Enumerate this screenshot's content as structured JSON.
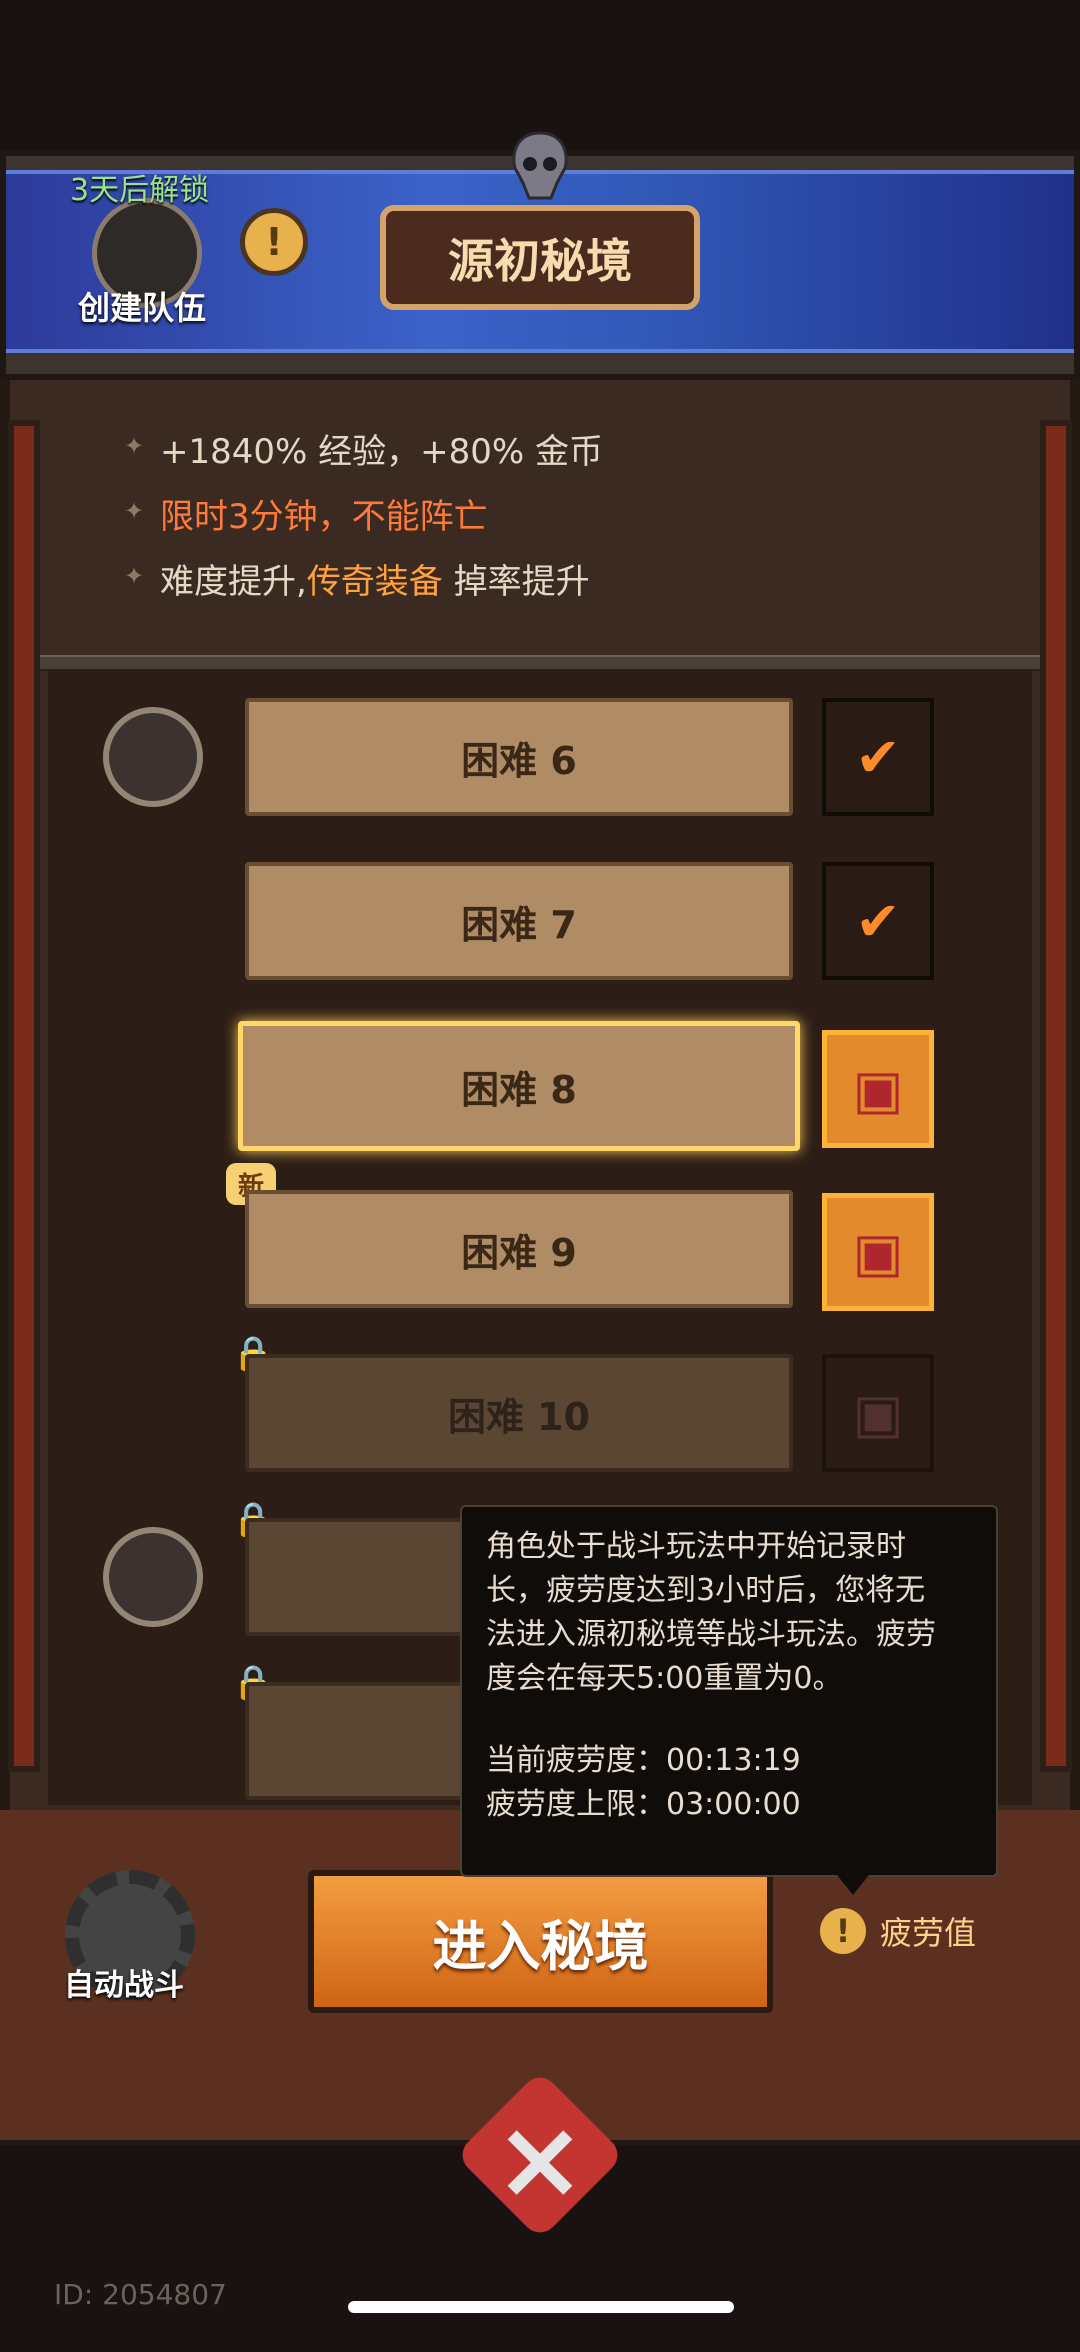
{
  "header": {
    "title": "源初秘境",
    "team": {
      "timer": "3天后解锁",
      "label": "创建队伍"
    },
    "info_icon": "exclamation-icon"
  },
  "description": {
    "line1": "+1840% 经验，+80% 金币",
    "line2": "限时3分钟，不能阵亡",
    "line3_prefix": "难度提升,",
    "line3_highlight": "传奇装备",
    "line3_suffix": " 掉率提升"
  },
  "levels": [
    {
      "label": "困难 6",
      "state": "cleared"
    },
    {
      "label": "困难 7",
      "state": "cleared"
    },
    {
      "label": "困难 8",
      "state": "selected"
    },
    {
      "label": "困难 9",
      "state": "new"
    },
    {
      "label": "困难 10",
      "state": "locked"
    }
  ],
  "new_badge": "新",
  "auto_battle": {
    "label": "自动战斗"
  },
  "enter_button": "进入秘境",
  "fatigue": {
    "label": "疲劳值"
  },
  "tooltip": {
    "line1": "角色处于战斗玩法中开始记录时",
    "line2": "长，疲劳度达到3小时后，您将无",
    "line3": "法进入源初秘境等战斗玩法。疲劳",
    "line4": "度会在每天5:00重置为0。",
    "current": "当前疲劳度：00:13:19",
    "limit": "疲劳度上限：03:00:00"
  },
  "user_id": "ID: 2054807",
  "colors": {
    "accent": "#ff7a3a",
    "gold": "#ffa23e",
    "selected": "#ffd869"
  }
}
